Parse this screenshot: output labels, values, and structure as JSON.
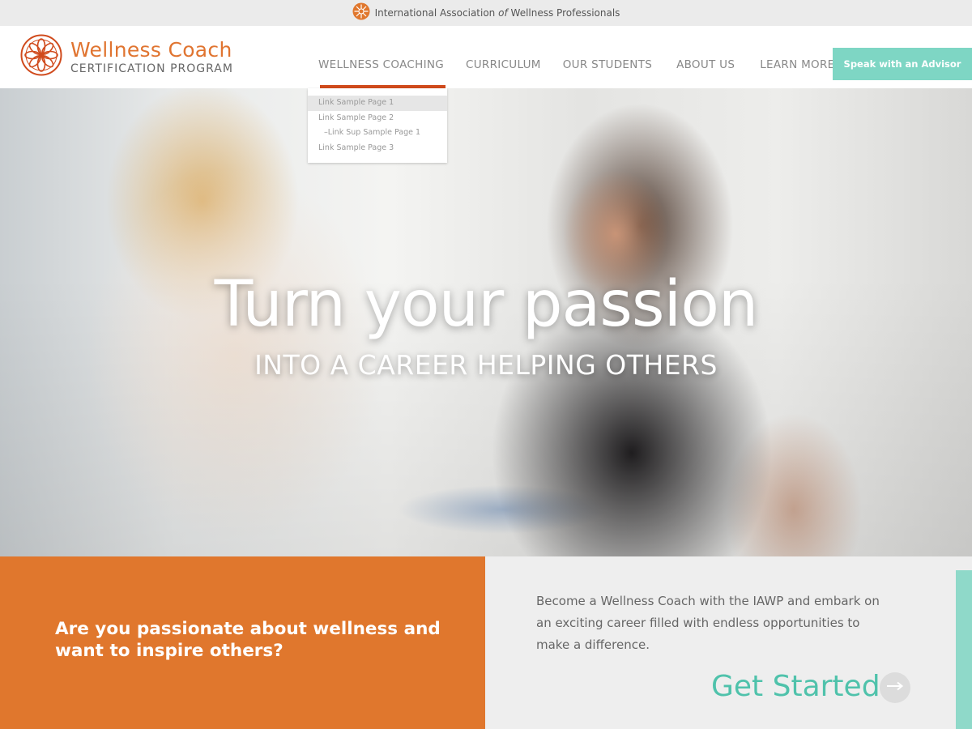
{
  "topbar": {
    "assoc_prefix": "International Association",
    "assoc_of": "of",
    "assoc_suffix": "Wellness Professionals"
  },
  "logo": {
    "title": "Wellness Coach",
    "subtitle": "CERTIFICATION PROGRAM"
  },
  "nav": {
    "items": [
      {
        "label": "WELLNESS COACHING"
      },
      {
        "label": "CURRICULUM"
      },
      {
        "label": "OUR STUDENTS"
      },
      {
        "label": "ABOUT US"
      },
      {
        "label": "LEARN MORE"
      }
    ],
    "advisor_label": "Speak with an Advisor"
  },
  "dropdown": {
    "items": [
      {
        "label": "Link Sample Page 1"
      },
      {
        "label": "Link Sample Page 2"
      },
      {
        "label": "–Link Sup Sample Page 1"
      },
      {
        "label": "Link Sample Page 3"
      }
    ]
  },
  "hero": {
    "title": "Turn your passion",
    "subtitle": "INTO A CAREER HELPING OTHERS"
  },
  "cta": {
    "question": "Are you passionate about wellness and want to inspire others?",
    "description": "Become a Wellness Coach with the IAWP and embark on an exciting career filled with endless opportunities to make a difference.",
    "button_label": "Get Started"
  },
  "colors": {
    "accent_orange": "#e0772d",
    "nav_underline": "#d04a1c",
    "teal": "#4fc2ab",
    "advisor_button": "#7ed6c4"
  },
  "icons": {
    "assoc_logo": "sunburst-icon",
    "brand_logo": "flower-mandala-icon",
    "cta_arrow": "arrow-right-icon"
  }
}
